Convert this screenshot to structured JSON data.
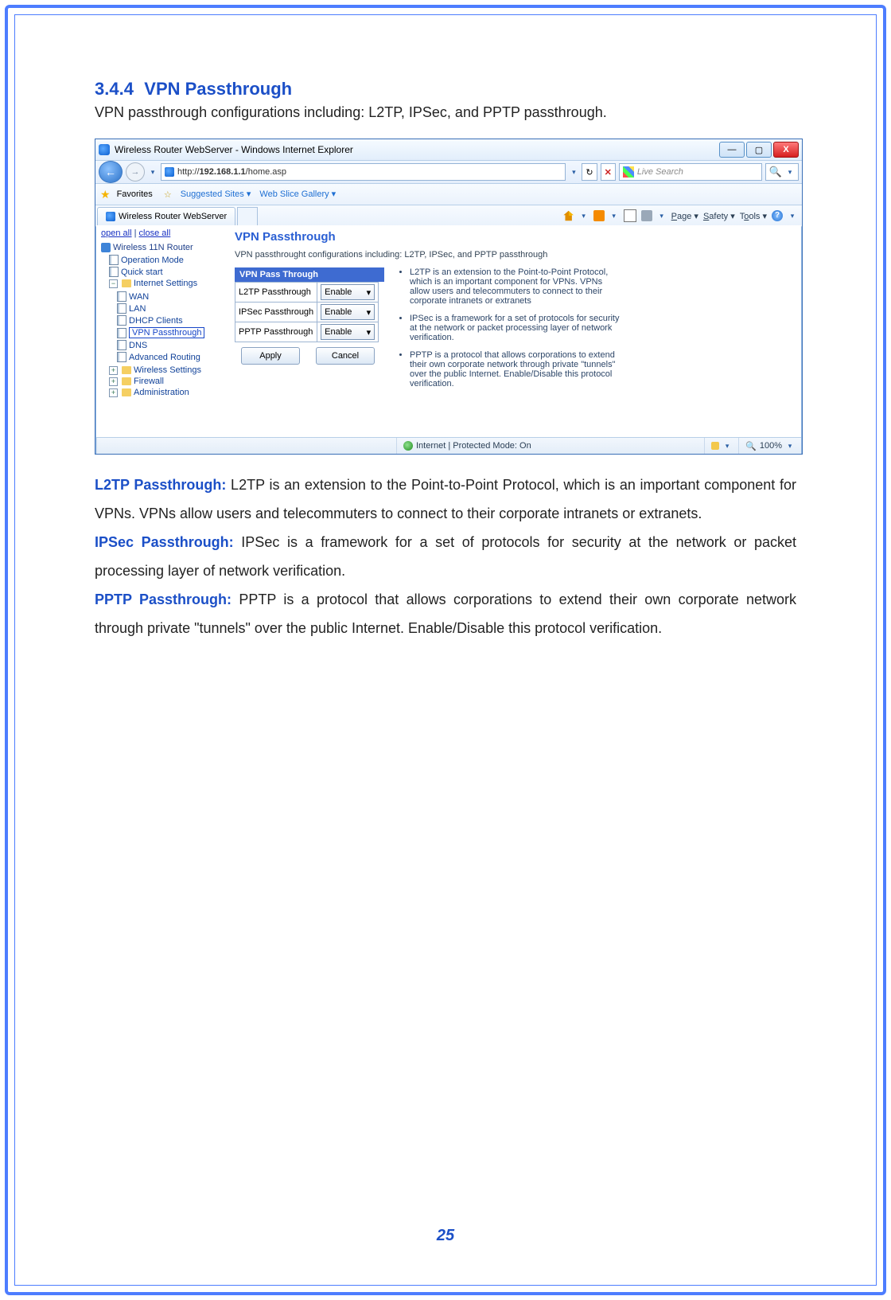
{
  "heading": {
    "num": "3.4.4",
    "title": "VPN Passthrough"
  },
  "intro": "VPN passthrough configurations including: L2TP, IPSec, and PPTP passthrough.",
  "page_num": "25",
  "browser": {
    "title": "Wireless Router WebServer - Windows Internet Explorer",
    "url_prefix": "http://",
    "url_host": "192.168.1.1",
    "url_path": "/home.asp",
    "search_placeholder": "Live Search",
    "fav_label": "Favorites",
    "suggested": "Suggested Sites",
    "webslice": "Web Slice Gallery",
    "tab_label": "Wireless Router WebServer",
    "cmd": {
      "page": "Page",
      "safety": "Safety",
      "tools": "Tools"
    },
    "status": {
      "mode": "Internet | Protected Mode: On",
      "zoom": "100%"
    }
  },
  "tree": {
    "open_all": "open all",
    "close_all": "close all",
    "root": "Wireless 11N Router",
    "items": {
      "operation_mode": "Operation Mode",
      "quick_start": "Quick start",
      "internet_settings": "Internet Settings",
      "wan": "WAN",
      "lan": "LAN",
      "dhcp": "DHCP Clients",
      "vpn": "VPN Passthrough",
      "dns": "DNS",
      "adv": "Advanced Routing",
      "wireless": "Wireless Settings",
      "firewall": "Firewall",
      "admin": "Administration"
    }
  },
  "panel": {
    "title": "VPN Passthrough",
    "subtitle": "VPN passthrought configurations including: L2TP, IPSec, and PPTP passthrough",
    "table_header": "VPN Pass Through",
    "rows": {
      "l2tp": "L2TP Passthrough",
      "ipsec": "IPSec Passthrough",
      "pptp": "PPTP Passthrough"
    },
    "option": "Enable",
    "apply": "Apply",
    "cancel": "Cancel",
    "info": {
      "l2tp": "L2TP is an extension to the Point-to-Point Protocol, which is an important component for VPNs. VPNs allow users and telecommuters to connect to their corporate intranets or extranets",
      "ipsec": "IPSec is a framework for a set of protocols for security at the network or packet processing layer of network verification.",
      "pptp": "PPTP is a protocol that allows corporations to extend their own corporate network through private \"tunnels\" over the public Internet. Enable/Disable this protocol verification."
    }
  },
  "defs": {
    "l2tp_term": "L2TP Passthrough:",
    "l2tp": " L2TP is an extension to the Point-to-Point Protocol, which is an important component for VPNs. VPNs allow users and telecommuters to connect to their corporate intranets or extranets.",
    "ipsec_term": "IPSec Passthrough:",
    "ipsec": " IPSec is a framework for a set of protocols for security at the network or packet processing layer of network verification.",
    "pptp_term": "PPTP Passthrough:",
    "pptp": " PPTP is a protocol that allows corporations to extend their own corporate network through private \"tunnels\" over the public Internet. Enable/Disable this protocol verification."
  }
}
